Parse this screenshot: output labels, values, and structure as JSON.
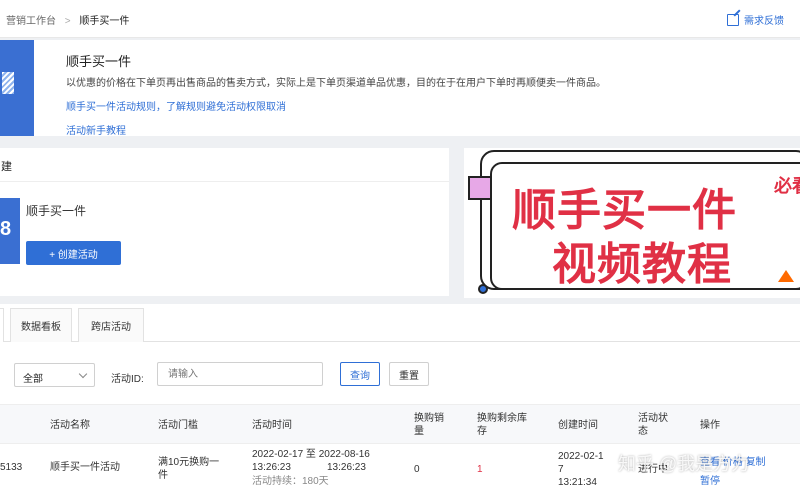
{
  "breadcrumb": {
    "parent": "营销工作台",
    "separator": ">",
    "current": "顺手买一件"
  },
  "feedback": {
    "label": "需求反馈"
  },
  "intro": {
    "title": "顺手买一件",
    "description": "以优惠的价格在下单页再出售商品的售卖方式，实际上是下单页渠道单品优惠，目的在于在用户下单时再顺便卖一件商品。",
    "rules_link": "顺手买一件活动规则，了解规则避免活动权限取消",
    "tutorial_link": "活动新手教程"
  },
  "create_section": {
    "heading": "建",
    "icon_text": "8",
    "item_name": "顺手买一件",
    "create_button": "+ 创建活动"
  },
  "banner": {
    "line1": "顺手买一件",
    "line2": "视频教程",
    "badge": "必看"
  },
  "tabs": [
    {
      "label": ""
    },
    {
      "label": "数据看板"
    },
    {
      "label": "跨店活动"
    }
  ],
  "filters": {
    "status_label": "：",
    "status_selected": "全部",
    "id_label": "活动ID:",
    "id_placeholder": "请输入",
    "query_button": "查询",
    "reset_button": "重置"
  },
  "table": {
    "headers": [
      "活动名称",
      "活动门槛",
      "活动时间",
      "换购销\n量",
      "换购剩余库\n存",
      "创建时间",
      "活动状\n态",
      "操作"
    ],
    "rows": [
      {
        "id": "5133",
        "name": "顺手买一件活动",
        "threshold": "满10元换购一\n件",
        "time_range": "2022-02-17 至 2022-08-16",
        "time_start": "13:26:23",
        "time_end": "13:26:23",
        "duration": "活动持续：180天",
        "sales": "0",
        "stock": "1",
        "created_date": "2022-02-1\n7",
        "created_time": "13:21:34",
        "status": "进行中",
        "actions": [
          "查看",
          "价格",
          "复制"
        ],
        "action_pause": "暂停"
      }
    ]
  },
  "watermark": "知乎 @我是方力",
  "colors": {
    "accent": "#2f6fd6",
    "banner_text": "#e03045",
    "stock_red": "#e03045"
  }
}
